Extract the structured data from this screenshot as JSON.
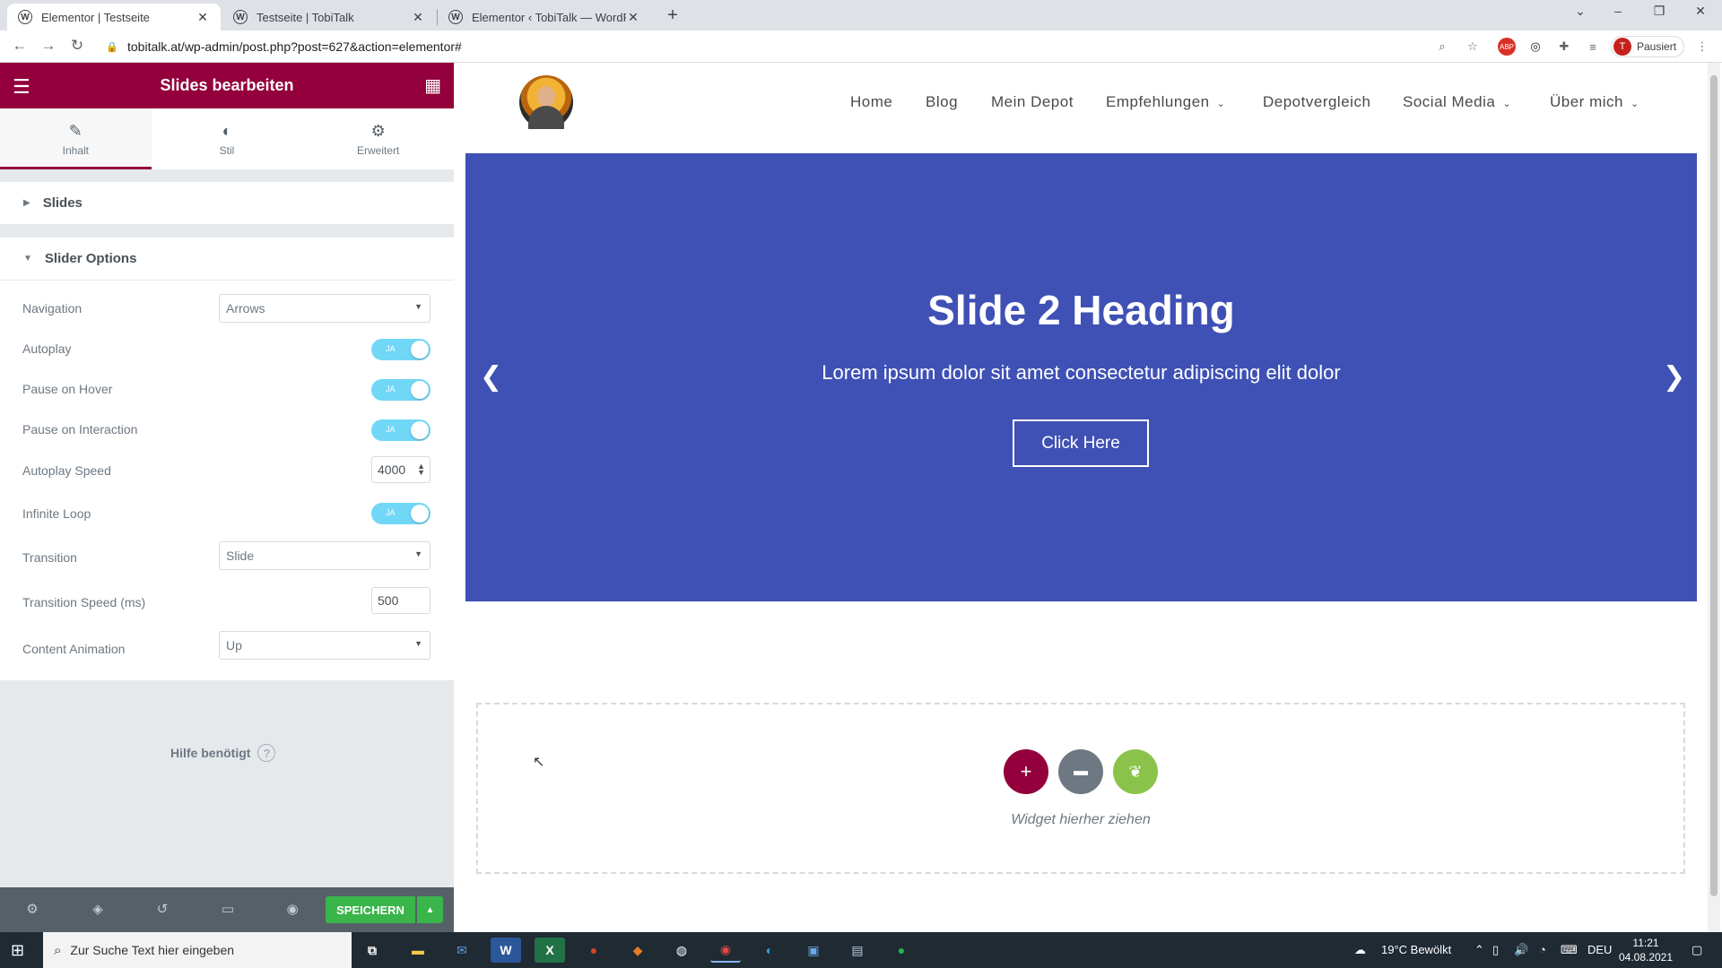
{
  "browser": {
    "tabs": [
      {
        "title": "Elementor | Testseite",
        "active": true
      },
      {
        "title": "Testseite | TobiTalk",
        "active": false
      },
      {
        "title": "Elementor ‹ TobiTalk — WordPre",
        "active": false
      }
    ],
    "url": "tobitalk.at/wp-admin/post.php?post=627&action=elementor#",
    "profile_initial": "T",
    "profile_label": "Pausiert"
  },
  "panel": {
    "title": "Slides bearbeiten",
    "tabs": [
      "Inhalt",
      "Stil",
      "Erweitert"
    ],
    "section_slides": "Slides",
    "section_options": "Slider Options",
    "controls": {
      "navigation_label": "Navigation",
      "navigation_value": "Arrows",
      "autoplay_label": "Autoplay",
      "pause_hover_label": "Pause on Hover",
      "pause_interaction_label": "Pause on Interaction",
      "autoplay_speed_label": "Autoplay Speed",
      "autoplay_speed_value": "4000",
      "infinite_loop_label": "Infinite Loop",
      "transition_label": "Transition",
      "transition_value": "Slide",
      "transition_speed_label": "Transition Speed (ms)",
      "transition_speed_value": "500",
      "content_animation_label": "Content Animation",
      "content_animation_value": "Up",
      "toggle_on_text": "JA"
    },
    "help_text": "Hilfe benötigt",
    "save_label": "SPEICHERN"
  },
  "site": {
    "menu": [
      {
        "label": "Home",
        "dropdown": false
      },
      {
        "label": "Blog",
        "dropdown": false
      },
      {
        "label": "Mein Depot",
        "dropdown": false
      },
      {
        "label": "Empfehlungen",
        "dropdown": true
      },
      {
        "label": "Depotvergleich",
        "dropdown": false
      },
      {
        "label": "Social Media",
        "dropdown": true
      },
      {
        "label": "Über mich",
        "dropdown": true
      }
    ],
    "slide_heading": "Slide 2 Heading",
    "slide_text": "Lorem ipsum dolor sit amet consectetur adipiscing elit dolor",
    "slide_button": "Click Here",
    "dropzone_text": "Widget hierher ziehen"
  },
  "taskbar": {
    "search_placeholder": "Zur Suche Text hier eingeben",
    "weather": "19°C  Bewölkt",
    "language": "DEU",
    "time": "11:21",
    "date": "04.08.2021"
  },
  "colors": {
    "elementor_maroon": "#93003c",
    "slide_bg": "#3f51b5",
    "toggle_on": "#71d7f7",
    "save_green": "#39b54a"
  }
}
